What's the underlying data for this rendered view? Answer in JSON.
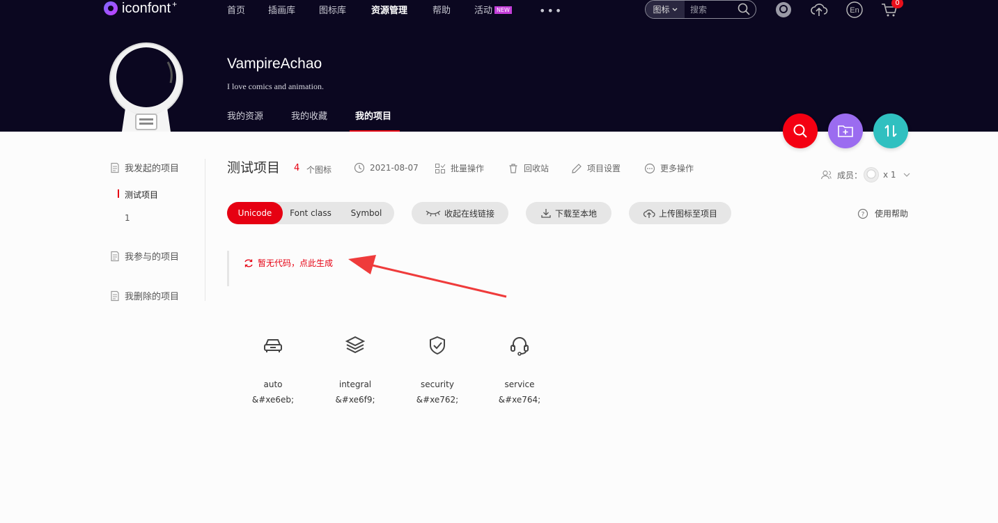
{
  "header": {
    "logo": "iconfont",
    "logo_star": "+",
    "nav": [
      {
        "label": "首页"
      },
      {
        "label": "插画库"
      },
      {
        "label": "图标库"
      },
      {
        "label": "资源管理"
      },
      {
        "label": "帮助"
      },
      {
        "label": "活动",
        "badge": "NEW"
      }
    ],
    "more": "•••",
    "search": {
      "type": "图标",
      "placeholder": "搜索"
    },
    "cart_count": "0"
  },
  "profile": {
    "name": "VampireAchao",
    "bio": "I love comics and animation.",
    "tabs": [
      {
        "label": "我的资源"
      },
      {
        "label": "我的收藏"
      },
      {
        "label": "我的项目"
      }
    ]
  },
  "sidebar": {
    "groups": [
      {
        "label": "我发起的项目",
        "items": [
          {
            "label": "测试项目"
          },
          {
            "label": "1"
          }
        ]
      },
      {
        "label": "我参与的项目"
      },
      {
        "label": "我删除的项目"
      }
    ]
  },
  "project": {
    "title": "测试项目",
    "icon_count": "4",
    "icon_count_unit": "个图标",
    "date": "2021-08-07",
    "actions": [
      {
        "label": "批量操作",
        "icon": "batch-icon"
      },
      {
        "label": "回收站",
        "icon": "trash-icon"
      },
      {
        "label": "项目设置",
        "icon": "pencil-icon"
      },
      {
        "label": "更多操作",
        "icon": "more-icon"
      }
    ],
    "members_label": "成员：",
    "members_count": "x 1",
    "code_tabs": [
      {
        "label": "Unicode"
      },
      {
        "label": "Font class"
      },
      {
        "label": "Symbol"
      }
    ],
    "buttons": {
      "collapse_link": "收起在线链接",
      "download": "下载至本地",
      "upload": "上传图标至项目"
    },
    "help": "使用帮助",
    "generate_code": "暂无代码，点此生成",
    "icons": [
      {
        "name": "auto",
        "code": "&#xe6eb;",
        "icon": "car-icon"
      },
      {
        "name": "integral",
        "code": "&#xe6f9;",
        "icon": "layers-icon"
      },
      {
        "name": "security",
        "code": "&#xe762;",
        "icon": "shield-check-icon"
      },
      {
        "name": "service",
        "code": "&#xe764;",
        "icon": "headset-icon"
      }
    ]
  },
  "colors": {
    "header_bg": "#0b0720",
    "accent": "#e60012",
    "fab_search": "#f40012",
    "fab_folder": "#9b6cf0",
    "fab_sort": "#30c0c0",
    "annotation_arrow": "#ef3b3b"
  }
}
